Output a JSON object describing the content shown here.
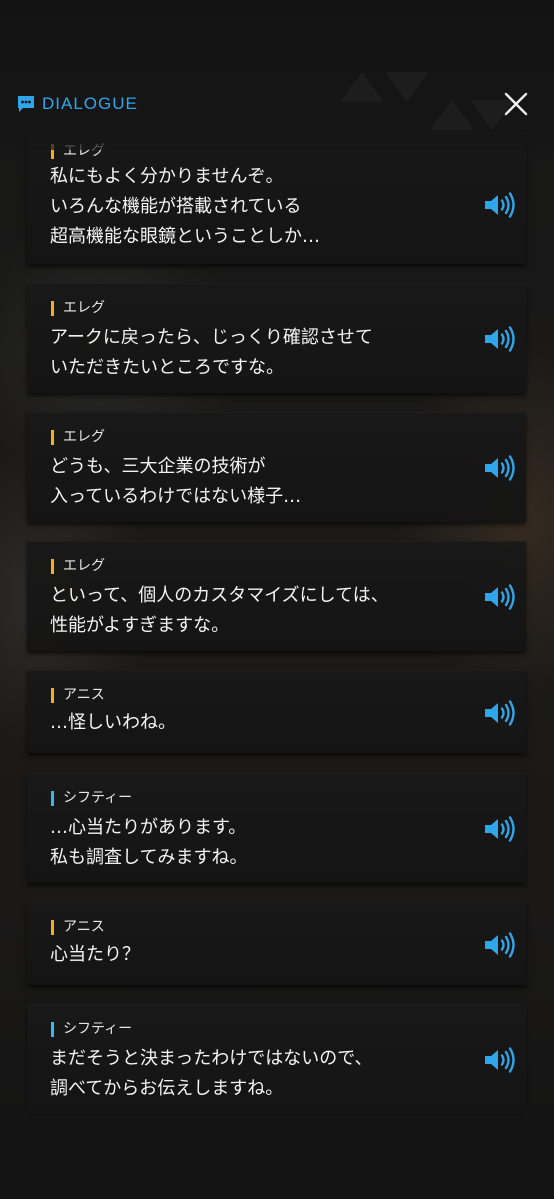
{
  "header": {
    "title": "DIALOGUE",
    "icon": "chat-bubble-icon",
    "close_icon": "close-icon",
    "accent_color": "#2fa6ea"
  },
  "speaker_colors": {
    "エレグ": "#f2b01e",
    "アニス": "#f2b01e",
    "シフティー": "#36b8f0"
  },
  "voice_icon": "speaker-volume-icon",
  "dialogue": [
    {
      "speaker": "エレグ",
      "lines": [
        "私にもよく分かりませんぞ。",
        "いろんな機能が搭載されている",
        "超高機能な眼鏡ということしか…"
      ]
    },
    {
      "speaker": "エレグ",
      "lines": [
        "アークに戻ったら、じっくり確認させて",
        "いただきたいところですな。"
      ]
    },
    {
      "speaker": "エレグ",
      "lines": [
        "どうも、三大企業の技術が",
        "入っているわけではない様子…"
      ]
    },
    {
      "speaker": "エレグ",
      "lines": [
        "といって、個人のカスタマイズにしては、",
        "性能がよすぎますな。"
      ]
    },
    {
      "speaker": "アニス",
      "lines": [
        "…怪しいわね。"
      ]
    },
    {
      "speaker": "シフティー",
      "lines": [
        "…心当たりがあります。",
        "私も調査してみますね。"
      ]
    },
    {
      "speaker": "アニス",
      "lines": [
        "心当たり？"
      ]
    },
    {
      "speaker": "シフティー",
      "lines": [
        "まだそうと決まったわけではないので、",
        "調べてからお伝えしますね。"
      ]
    }
  ]
}
